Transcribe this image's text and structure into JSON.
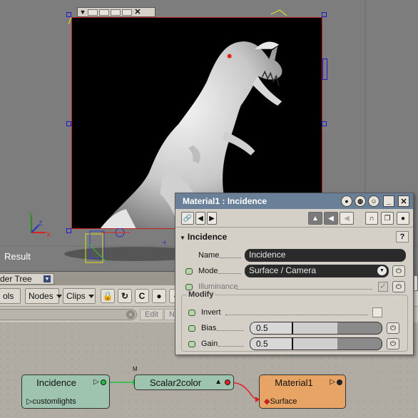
{
  "viewport": {
    "result_label": "Result"
  },
  "node_tree": {
    "tab_label": "der Tree",
    "toolbar": {
      "tools_label": "ols",
      "nodes_label": "Nodes",
      "clips_label": "Clips"
    },
    "subbar": {
      "edit_label": "Edit",
      "next_label": "N"
    },
    "nodes": {
      "incidence": {
        "title": "Incidence",
        "port": "customlights"
      },
      "scalar2color": {
        "title": "Scalar2color",
        "marker": "M"
      },
      "material": {
        "title": "Material1",
        "port": "Surface"
      }
    }
  },
  "property_panel": {
    "title": "Material1 : Incidence",
    "section": "Incidence",
    "name_label": "Name",
    "name_value": "Incidence",
    "mode_label": "Mode",
    "mode_value": "Surface / Camera",
    "illuminance_label": "Illuminance",
    "illuminance_checked": true,
    "modify_label": "Modify",
    "invert_label": "Invert",
    "invert_checked": false,
    "bias_label": "Bias",
    "bias_value": "0.5",
    "gain_label": "Gain",
    "gain_value": "0.5"
  },
  "colors": {
    "title_bar": "#6a8098",
    "node_green": "#9ec4b0",
    "node_orange": "#e8a464",
    "render_border": "#c02020",
    "handles": "#1a1ad0"
  }
}
